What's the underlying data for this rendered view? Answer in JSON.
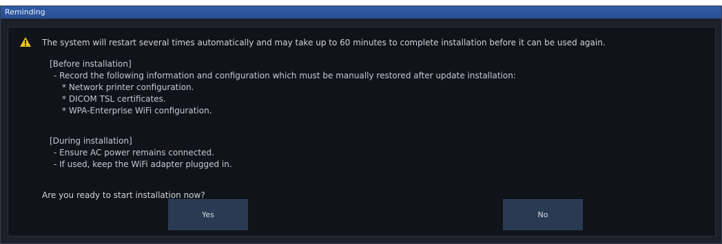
{
  "dialog": {
    "title": "Reminding",
    "icon": "warning-icon",
    "colors": {
      "title_bar": "#2f5aa5",
      "background": "#10141a",
      "text": "#c4c9d2",
      "button": "#2a3a52",
      "warning": "#f0c419"
    },
    "message": "The system will restart several times automatically and may take up to 60 minutes to complete installation before it can be used again.",
    "before_heading": "[Before installation]",
    "before_intro": "- Record the following information and configuration which must be manually restored after update installation:",
    "before_items": [
      "* Network printer configuration.",
      "* DICOM TSL certificates.",
      "* WPA-Enterprise WiFi configuration."
    ],
    "during_heading": "[During installation]",
    "during_items": [
      "- Ensure AC power remains connected.",
      "- If used, keep the WiFi adapter plugged in."
    ],
    "question": "Are you ready to start installation now?",
    "yes_label": "Yes",
    "no_label": "No"
  }
}
